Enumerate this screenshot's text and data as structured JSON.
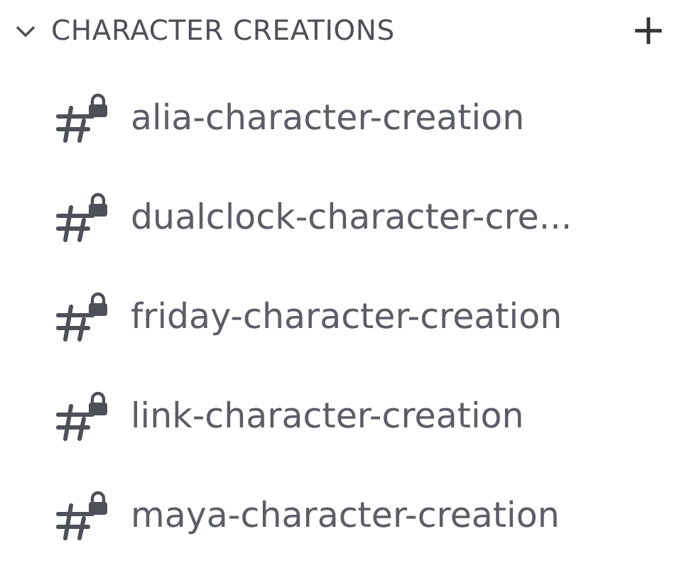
{
  "category": {
    "title": "CHARACTER CREATIONS",
    "expanded": true,
    "add_label": "+"
  },
  "channels": [
    {
      "name": "alia-character-creation",
      "kind": "locked"
    },
    {
      "name": "dualclock-character-cre...",
      "kind": "locked"
    },
    {
      "name": "friday-character-creation",
      "kind": "locked"
    },
    {
      "name": "link-character-creation",
      "kind": "locked"
    },
    {
      "name": "maya-character-creation",
      "kind": "locked"
    }
  ]
}
